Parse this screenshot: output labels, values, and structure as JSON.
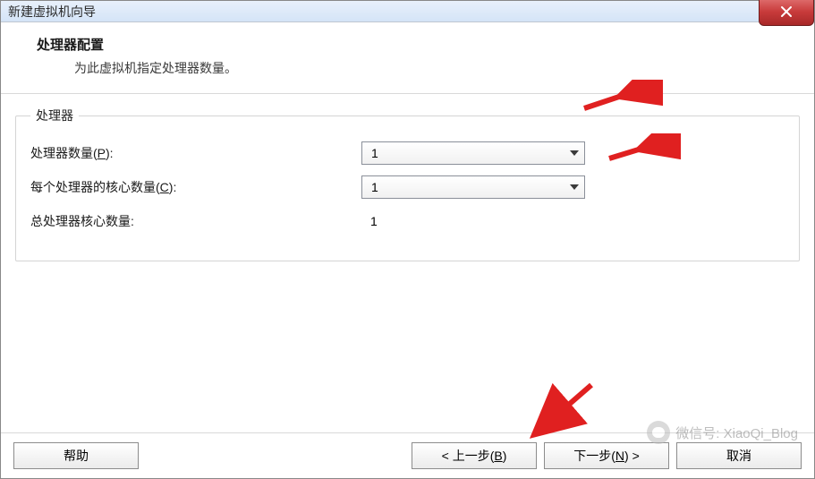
{
  "window": {
    "title": "新建虚拟机向导"
  },
  "header": {
    "title": "处理器配置",
    "sub": "为此虚拟机指定处理器数量。"
  },
  "group": {
    "legend": "处理器"
  },
  "proc_count": {
    "label_pre": "处理器数量(",
    "label_key": "P",
    "label_post": "):",
    "value": "1"
  },
  "cores_per": {
    "label_pre": "每个处理器的核心数量(",
    "label_key": "C",
    "label_post": "):",
    "value": "1"
  },
  "total": {
    "label": "总处理器核心数量:",
    "value": "1"
  },
  "buttons": {
    "help": "帮助",
    "back_pre": "< 上一步(",
    "back_key": "B",
    "back_post": ")",
    "next_pre": "下一步(",
    "next_key": "N",
    "next_post": ") >",
    "cancel": "取消"
  },
  "watermark": "微信号: XiaoQi_Blog"
}
